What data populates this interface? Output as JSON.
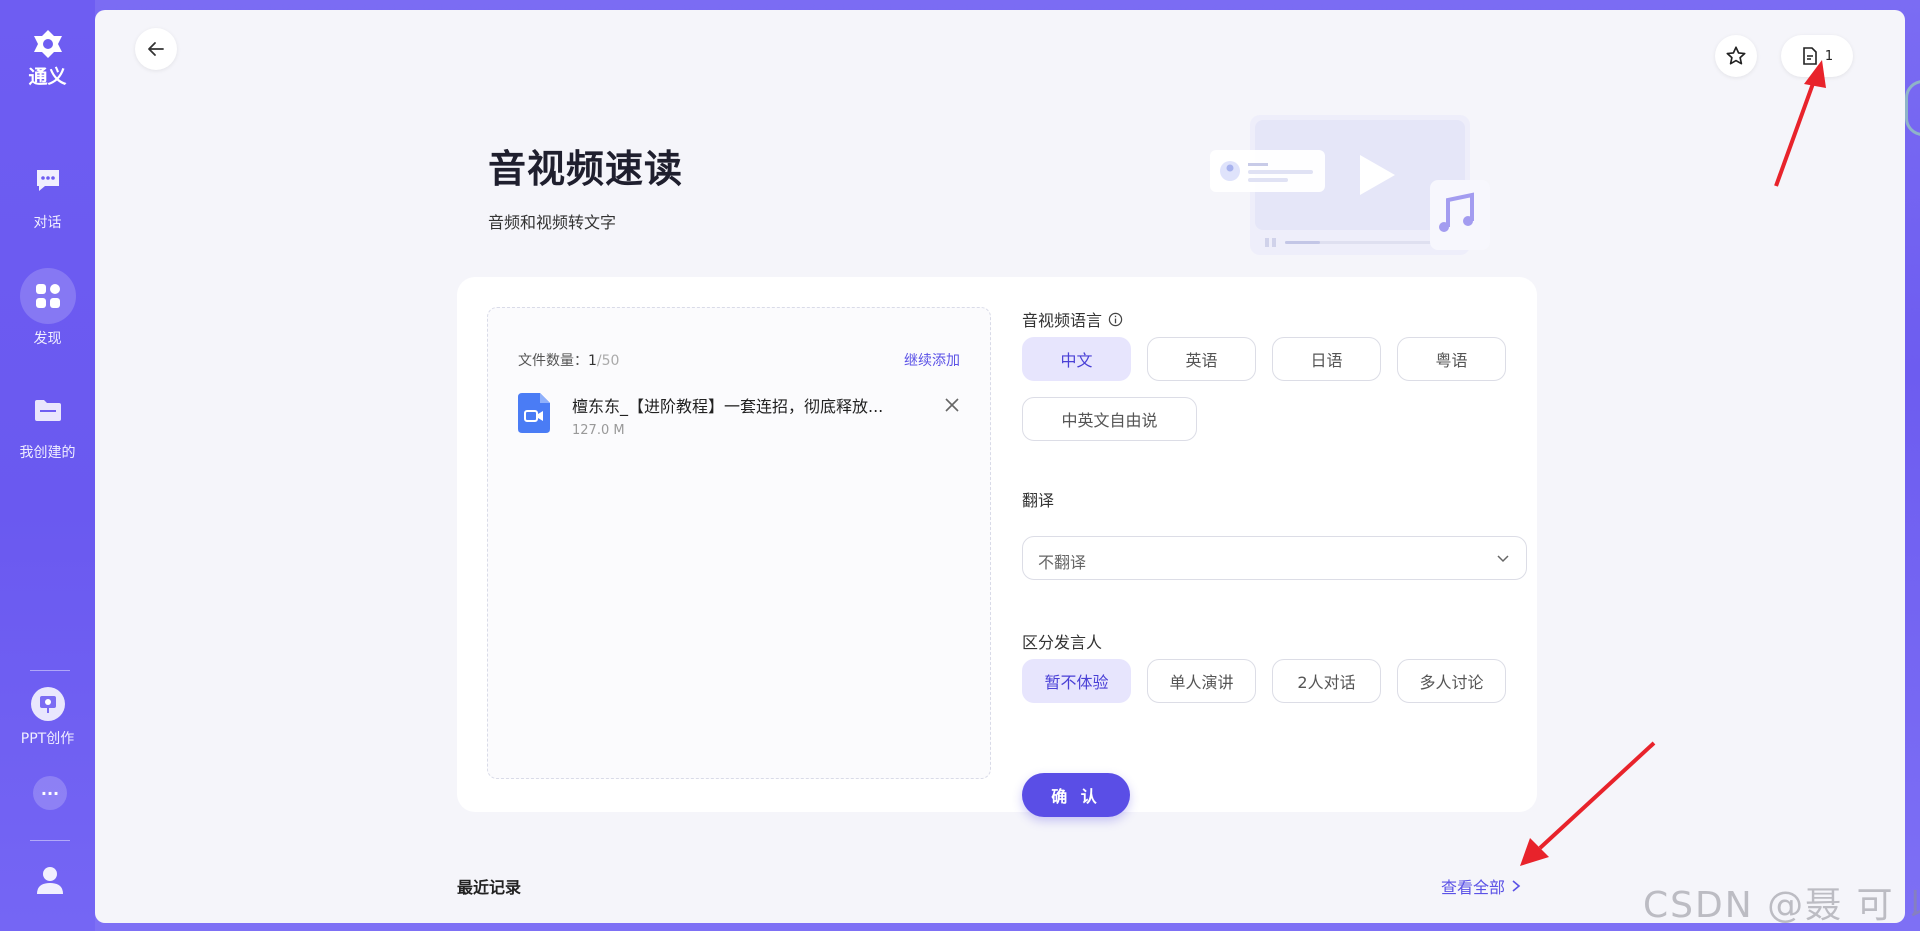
{
  "sidebar": {
    "logo_text": "通义",
    "items": [
      {
        "label": "对话",
        "icon": "chat-icon"
      },
      {
        "label": "发现",
        "icon": "apps-grid-icon",
        "active": true
      },
      {
        "label": "我创建的",
        "icon": "folder-icon"
      },
      {
        "label": "PPT创作",
        "icon": "ppt-icon"
      }
    ],
    "more_label": "···"
  },
  "header": {
    "doc_count": "1"
  },
  "page": {
    "title": "音视频速读",
    "subtitle": "音频和视频转文字"
  },
  "upload": {
    "count_label": "文件数量：",
    "count_current": "1",
    "count_max": "/50",
    "add_more": "继续添加",
    "files": [
      {
        "name": "檀东东_【进阶教程】一套连招，彻底释放...",
        "size": "127.0 M"
      }
    ]
  },
  "settings": {
    "language_label": "音视频语言",
    "languages": [
      "中文",
      "英语",
      "日语",
      "粤语",
      "中英文自由说"
    ],
    "language_selected": "中文",
    "translate_label": "翻译",
    "translate_value": "不翻译",
    "speaker_label": "区分发言人",
    "speakers": [
      "暂不体验",
      "单人演讲",
      "2人对话",
      "多人讨论"
    ],
    "speaker_selected": "暂不体验",
    "confirm": "确 认"
  },
  "recent": {
    "label": "最近记录",
    "view_all": "查看全部"
  },
  "watermark": "CSDN @聂 可 以",
  "colors": {
    "accent": "#5a4ee6",
    "sidebar": "#6e5df2",
    "annotation_arrow": "#e8232b"
  }
}
